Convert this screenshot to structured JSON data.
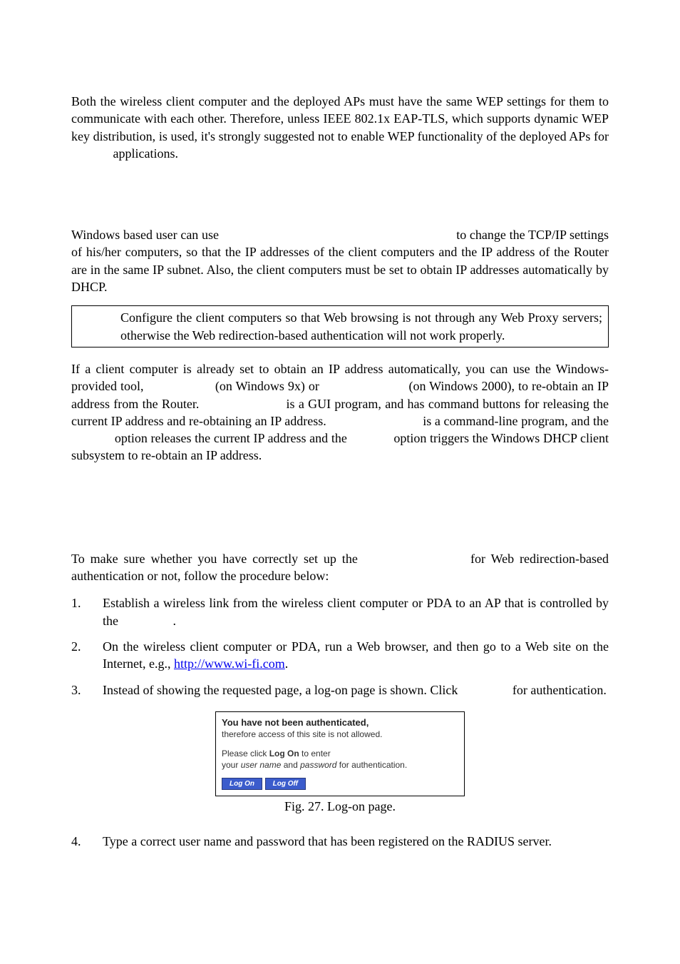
{
  "p1": "Both the wireless client computer and the deployed APs must have the same WEP settings for them to communicate with each other. Therefore, unless IEEE 802.1x EAP-TLS, which supports dynamic WEP key distribution, is used, it's strongly suggested not to enable WEP functionality of the deployed APs for              applications.",
  "p2": "Windows based user can use                                                                       to change the TCP/IP settings of his/her computers, so that the IP addresses of the client computers and the IP address of the Router are in the same IP subnet. Also, the client computers must be set to obtain IP addresses automatically by DHCP.",
  "note": "Configure the client computers so that Web browsing is not through any Web Proxy servers; otherwise the Web redirection-based authentication will not work properly.",
  "p3": "If a client computer is already set to obtain an IP address automatically, you can use the Windows-provided tool,                    (on Windows 9x) or                         (on Windows 2000), to re-obtain an IP address from the Router.                       is a GUI program, and has command buttons for releasing the current IP address and re-obtaining an IP address.                             is a command-line program, and the              option releases the current IP address and the              option triggers the Windows DHCP client subsystem to re-obtain an IP address.",
  "p4": "To make sure whether you have correctly set up the                    for Web redirection-based authentication or not, follow the procedure below:",
  "list": {
    "n1": "1.",
    "t1": "Establish a wireless link from the wireless client computer or PDA to an AP that is controlled by the                 .",
    "n2": "2.",
    "t2a": "On the wireless client computer or PDA, run a Web browser, and then go to a Web site on the Internet, e.g., ",
    "link_url": "http://www.wi-fi.com",
    "t2b": ".",
    "n3": "3.",
    "t3": "Instead of showing the requested page, a log-on page is shown. Click                 for authentication.",
    "n4": "4.",
    "t4": "Type a correct user name and password that has been registered on the RADIUS server."
  },
  "dialog": {
    "line1": "You have not been authenticated,",
    "line2": "therefore access of this site is not allowed.",
    "line3a": "Please click ",
    "line3b": "Log On",
    "line3c": " to enter",
    "line4a": "your ",
    "line4b": "user name",
    "line4c": " and ",
    "line4d": "password",
    "line4e": " for authentication.",
    "btn_on": "Log On",
    "btn_off": "Log Off"
  },
  "caption": "Fig. 27. Log-on page."
}
